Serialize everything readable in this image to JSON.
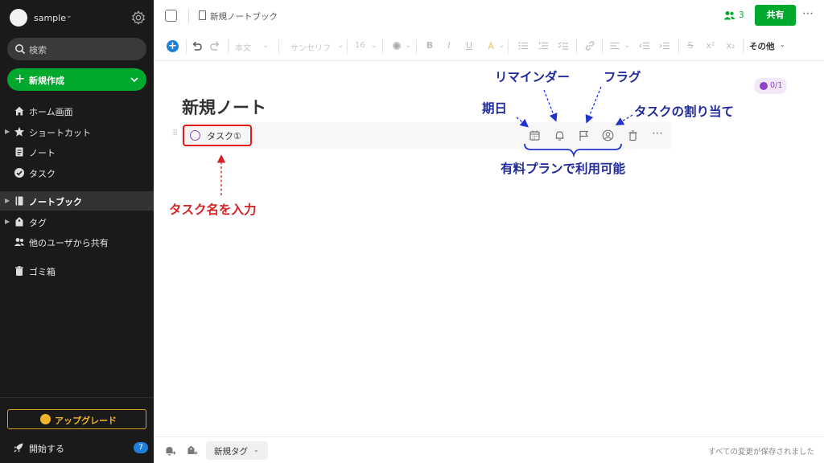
{
  "sidebar": {
    "user_name": "sample",
    "search_placeholder": "検索",
    "new_button": "新規作成",
    "nav": [
      {
        "label": "ホーム画面",
        "icon": "home-icon"
      },
      {
        "label": "ショートカット",
        "icon": "star-icon"
      },
      {
        "label": "ノート",
        "icon": "note-icon"
      },
      {
        "label": "タスク",
        "icon": "task-check-icon"
      },
      {
        "label": "ノートブック",
        "icon": "notebook-icon",
        "active": true
      },
      {
        "label": "タグ",
        "icon": "tag-icon"
      },
      {
        "label": "他のユーザから共有",
        "icon": "shared-users-icon"
      },
      {
        "label": "ゴミ箱",
        "icon": "trash-icon"
      }
    ],
    "upgrade": "アップグレード",
    "get_started": "開始する",
    "get_started_badge": "7"
  },
  "topbar": {
    "notebook": "新規ノートブック",
    "shared_count": "3",
    "share_button": "共有"
  },
  "toolbar": {
    "style": "本文",
    "font": "サンセリフ",
    "size": "16",
    "more": "その他"
  },
  "editor": {
    "task_progress": "0/1",
    "title": "新規ノート",
    "task_name": "タスク①"
  },
  "annotations": {
    "reminder": "リマインダー",
    "flag": "フラグ",
    "due_date": "期日",
    "assign": "タスクの割り当て",
    "paid": "有料プランで利用可能",
    "enter_task": "タスク名を入力"
  },
  "bottombar": {
    "new_tag": "新規タグ",
    "saved_status": "すべての変更が保存されました"
  },
  "colors": {
    "accent_green": "#00a82d",
    "annotation_blue": "#1f2a9c",
    "annotation_red": "#d42222",
    "task_purple": "#8e44c4"
  }
}
